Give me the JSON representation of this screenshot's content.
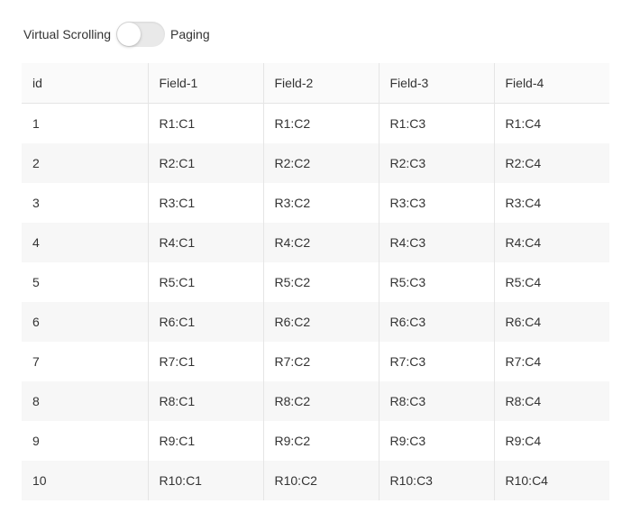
{
  "toggle": {
    "left_label": "Virtual Scrolling",
    "right_label": "Paging",
    "state": "virtual_scrolling"
  },
  "table": {
    "columns": [
      "id",
      "Field-1",
      "Field-2",
      "Field-3",
      "Field-4"
    ],
    "rows": [
      {
        "id": "1",
        "c1": "R1:C1",
        "c2": "R1:C2",
        "c3": "R1:C3",
        "c4": "R1:C4"
      },
      {
        "id": "2",
        "c1": "R2:C1",
        "c2": "R2:C2",
        "c3": "R2:C3",
        "c4": "R2:C4"
      },
      {
        "id": "3",
        "c1": "R3:C1",
        "c2": "R3:C2",
        "c3": "R3:C3",
        "c4": "R3:C4"
      },
      {
        "id": "4",
        "c1": "R4:C1",
        "c2": "R4:C2",
        "c3": "R4:C3",
        "c4": "R4:C4"
      },
      {
        "id": "5",
        "c1": "R5:C1",
        "c2": "R5:C2",
        "c3": "R5:C3",
        "c4": "R5:C4"
      },
      {
        "id": "6",
        "c1": "R6:C1",
        "c2": "R6:C2",
        "c3": "R6:C3",
        "c4": "R6:C4"
      },
      {
        "id": "7",
        "c1": "R7:C1",
        "c2": "R7:C2",
        "c3": "R7:C3",
        "c4": "R7:C4"
      },
      {
        "id": "8",
        "c1": "R8:C1",
        "c2": "R8:C2",
        "c3": "R8:C3",
        "c4": "R8:C4"
      },
      {
        "id": "9",
        "c1": "R9:C1",
        "c2": "R9:C2",
        "c3": "R9:C3",
        "c4": "R9:C4"
      },
      {
        "id": "10",
        "c1": "R10:C1",
        "c2": "R10:C2",
        "c3": "R10:C3",
        "c4": "R10:C4"
      }
    ]
  }
}
